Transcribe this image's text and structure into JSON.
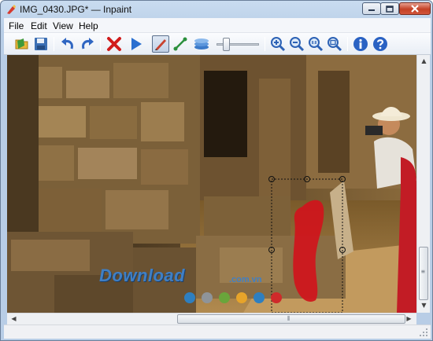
{
  "window": {
    "title": "IMG_0430.JPG* — Inpaint",
    "colors": {
      "titlebar": "#c9dcf0",
      "close_button": "#c44125"
    }
  },
  "menu": {
    "items": [
      {
        "label": "File"
      },
      {
        "label": "Edit"
      },
      {
        "label": "View"
      },
      {
        "label": "Help"
      }
    ]
  },
  "toolbar": {
    "buttons": [
      {
        "icon": "open-folder-icon"
      },
      {
        "icon": "save-disk-icon"
      },
      {
        "icon": "undo-arrow-icon"
      },
      {
        "icon": "redo-arrow-icon"
      },
      {
        "icon": "erase-red-x-icon"
      },
      {
        "icon": "run-play-icon"
      },
      {
        "icon": "marker-pen-icon",
        "pressed": true
      },
      {
        "icon": "line-tool-icon"
      },
      {
        "icon": "layers-stack-icon"
      },
      {
        "icon": "zoom-in-icon"
      },
      {
        "icon": "zoom-out-icon"
      },
      {
        "icon": "zoom-actual-size-icon"
      },
      {
        "icon": "zoom-fit-icon"
      },
      {
        "icon": "info-icon"
      },
      {
        "icon": "help-icon"
      }
    ],
    "brush_size_slider": {
      "value_fraction": 0.18
    }
  },
  "canvas": {
    "image_name": "IMG_0430.JPG",
    "selection_marker_color": "#d0141c",
    "watermark": {
      "text": "Download",
      "suffix": ".com.vn"
    },
    "watermark_dot_colors": [
      "#2e7fc0",
      "#8f9499",
      "#6aa53b",
      "#e7a42a",
      "#2e7fc0",
      "#cf2a2a"
    ]
  },
  "scrollbars": {
    "vertical": {
      "position_fraction": 0.85
    },
    "horizontal": {
      "position_fraction": 0.55
    }
  }
}
